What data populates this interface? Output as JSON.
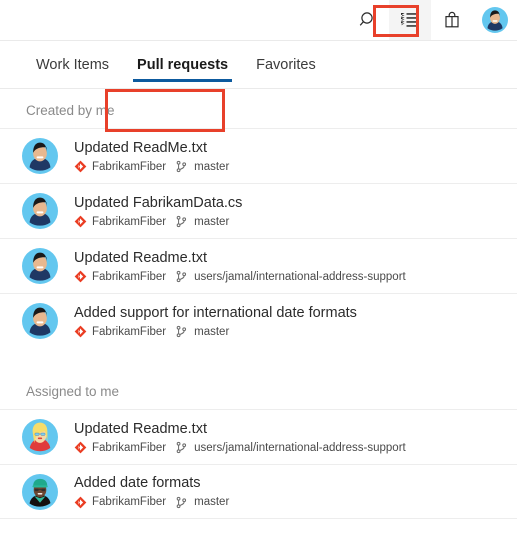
{
  "topbar": {
    "icons": [
      {
        "name": "search-icon",
        "label": "Search"
      },
      {
        "name": "work-queue-icon",
        "label": "My work items"
      },
      {
        "name": "marketplace-bag-icon",
        "label": "Marketplace"
      }
    ],
    "avatar_label": "User profile"
  },
  "callout_color": "#e8402a",
  "accent_color": "#0d5a9e",
  "repo_icon_color": "#ea3c22",
  "tabs": [
    {
      "label": "Work Items",
      "selected": false
    },
    {
      "label": "Pull requests",
      "selected": true
    },
    {
      "label": "Favorites",
      "selected": false
    }
  ],
  "sections": [
    {
      "title": "Created by me",
      "items": [
        {
          "title": "Updated ReadMe.txt",
          "repo": "FabrikamFiber",
          "branch": "master",
          "avatar": "man-dark-hair"
        },
        {
          "title": "Updated FabrikamData.cs",
          "repo": "FabrikamFiber",
          "branch": "master",
          "avatar": "man-dark-hair"
        },
        {
          "title": "Updated Readme.txt",
          "repo": "FabrikamFiber",
          "branch": "users/jamal/international-address-support",
          "avatar": "man-dark-hair"
        },
        {
          "title": "Added support for international date formats",
          "repo": "FabrikamFiber",
          "branch": "master",
          "avatar": "man-dark-hair"
        }
      ]
    },
    {
      "title": "Assigned to me",
      "items": [
        {
          "title": "Updated Readme.txt",
          "repo": "FabrikamFiber",
          "branch": "users/jamal/international-address-support",
          "avatar": "woman-blonde-glasses"
        },
        {
          "title": "Added date formats",
          "repo": "FabrikamFiber",
          "branch": "master",
          "avatar": "person-green-cap"
        }
      ]
    }
  ]
}
